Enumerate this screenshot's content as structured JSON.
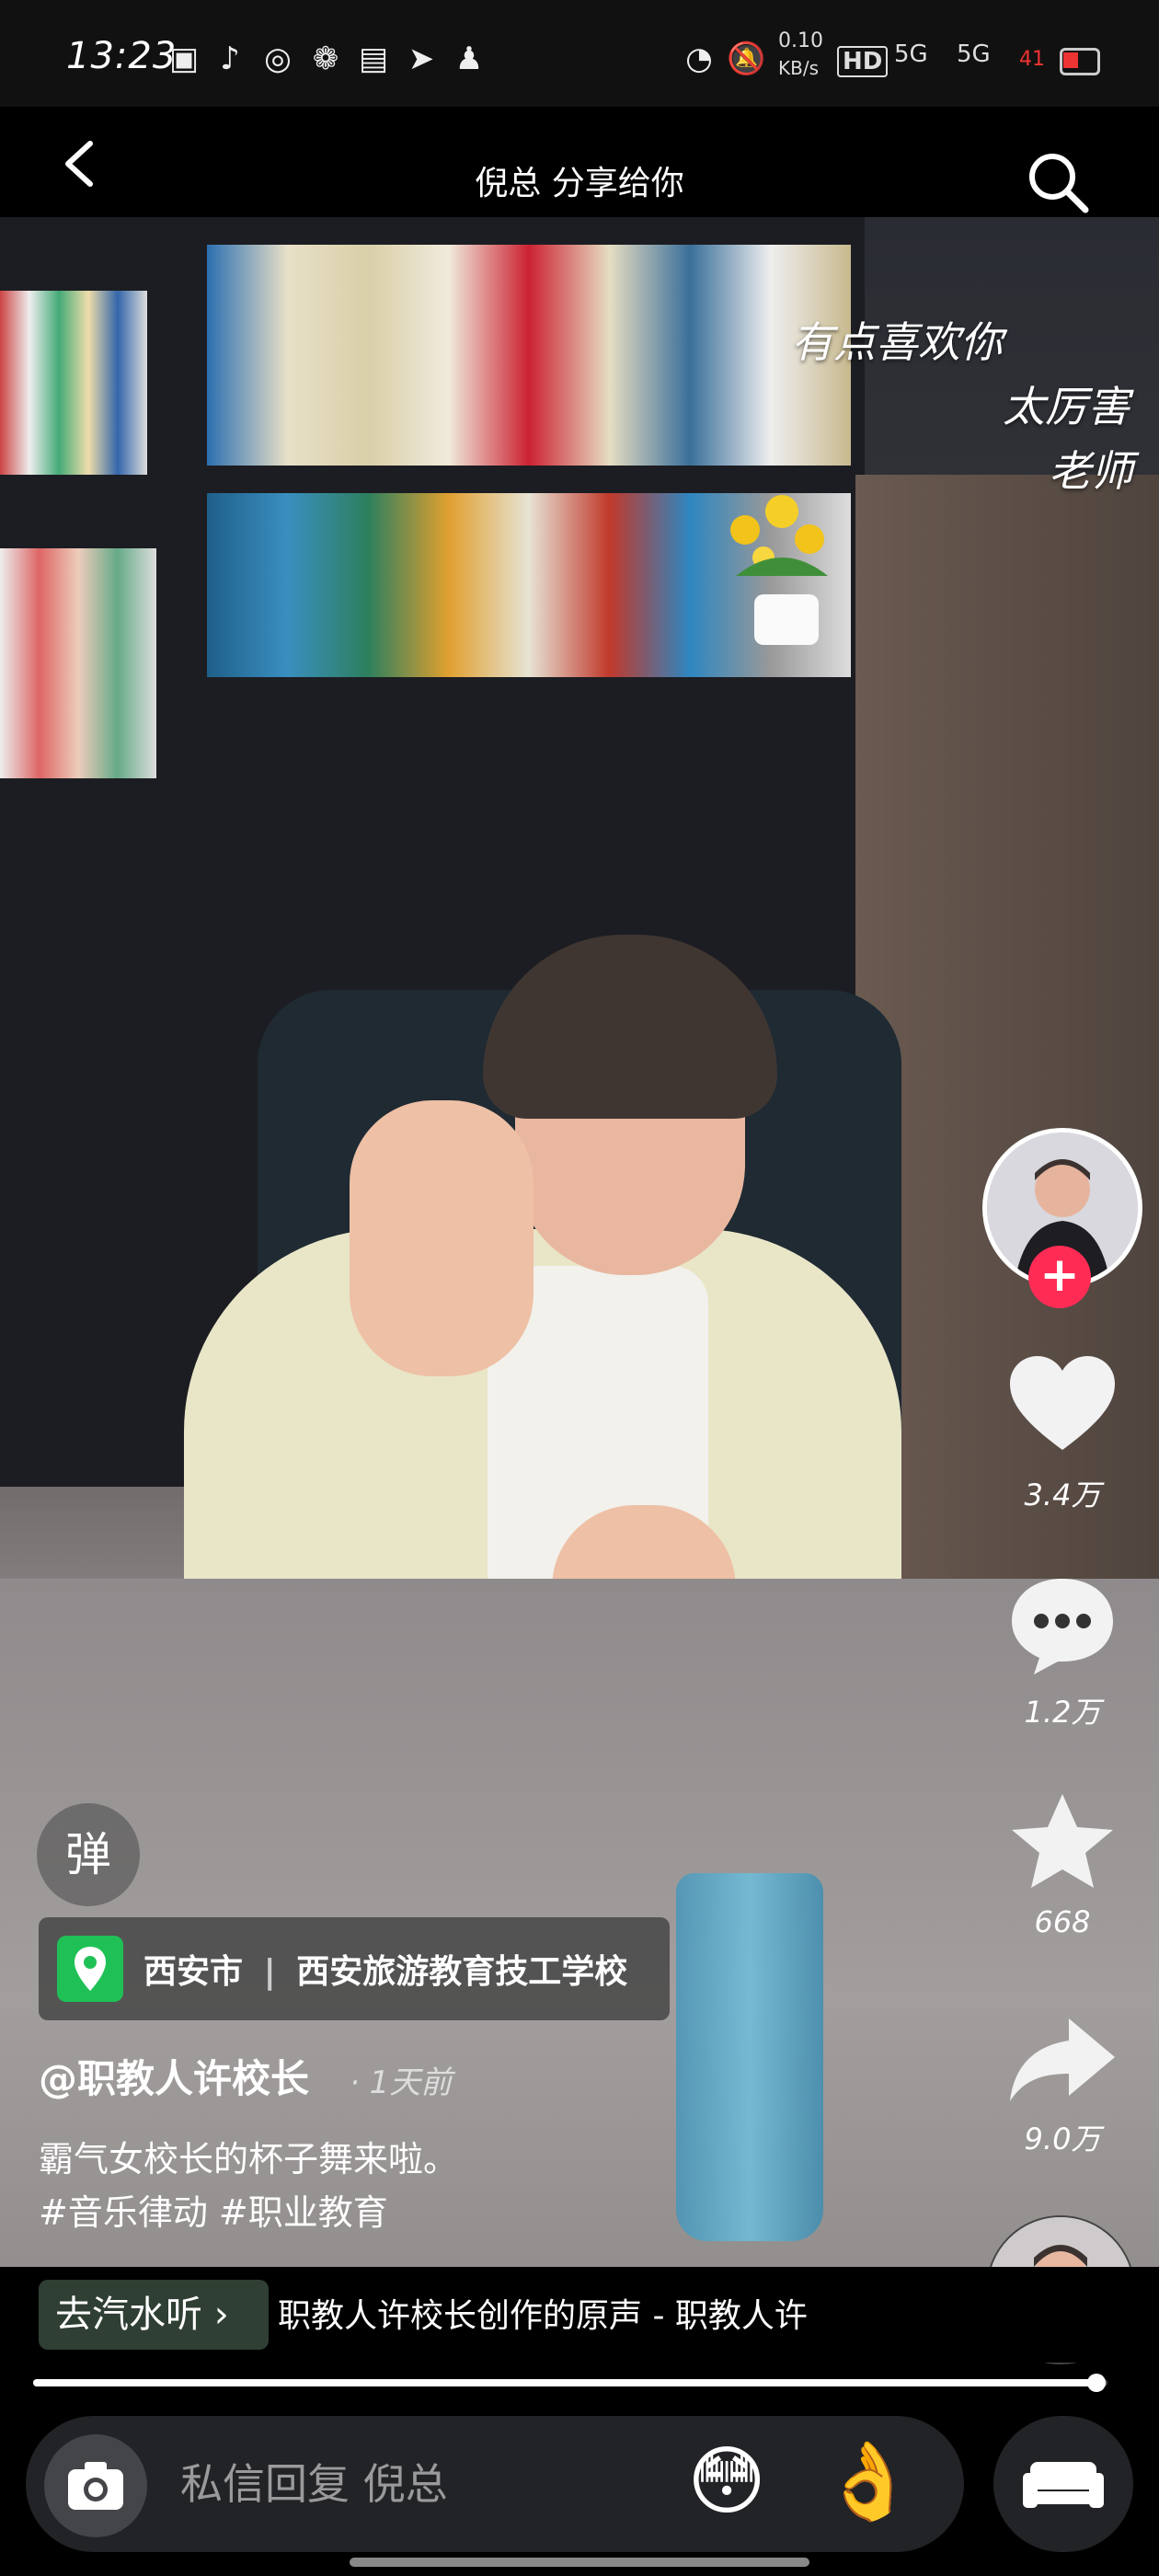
{
  "status_bar": {
    "time": "13:23",
    "network_speed_value": "0.10",
    "network_speed_unit": "KB/s",
    "hd_label": "HD",
    "signal1_label": "5G",
    "signal2_label": "5G",
    "battery_level": "41",
    "icons": [
      "notification-app-icon",
      "tiktok-icon",
      "weibo-icon",
      "wechat-icon",
      "alipay-icon",
      "telegram-icon",
      "qq-icon",
      "speedometer-icon",
      "mute-icon"
    ]
  },
  "header": {
    "title": "倪总 分享给你",
    "back_icon": "chevron-left-icon",
    "search_icon": "search-icon"
  },
  "video": {
    "overlay_lines": [
      "有点喜欢你",
      "太厉害",
      "老师"
    ]
  },
  "actions": {
    "likes": "3.4万",
    "comments": "1.2万",
    "favorites": "668",
    "shares": "9.0万",
    "follow_symbol": "+"
  },
  "info": {
    "danmu_label": "弹",
    "location_city": "西安市",
    "location_separator": "|",
    "location_place": "西安旅游教育技工学校",
    "author": "@职教人许校长",
    "time_ago": "· 1天前",
    "caption_line1": "霸气女校长的杯子舞来啦。",
    "caption_line2": "#音乐律动 #职业教育"
  },
  "music": {
    "listen_label": "去汽水听",
    "title": "职教人许校长创作的原声 - 职教人许"
  },
  "progress": {
    "fraction": 0.99
  },
  "reply": {
    "placeholder": "私信回复 倪总",
    "emoji1": "😳",
    "emoji2": "👌"
  },
  "colors": {
    "follow_red": "#fe2c55",
    "location_green": "#1fc156",
    "background": "#000000"
  }
}
